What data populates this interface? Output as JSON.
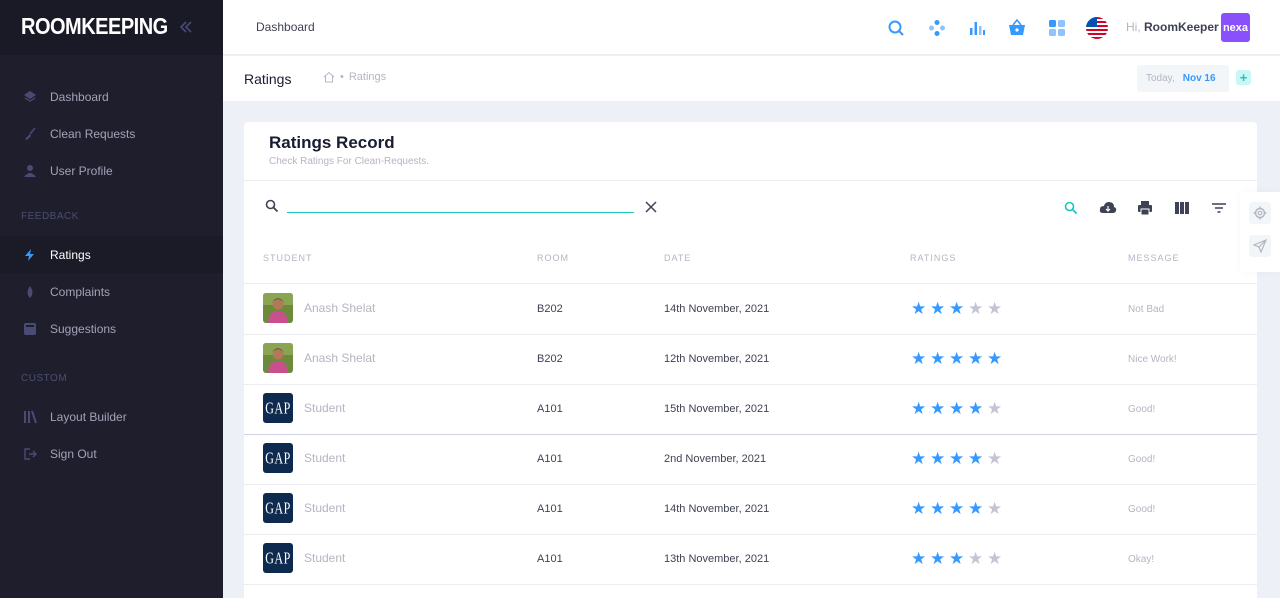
{
  "brand": {
    "name": "ROOMKEEPING"
  },
  "sidebar": {
    "items": [
      {
        "label": "Dashboard",
        "icon": "layers-icon"
      },
      {
        "label": "Clean Requests",
        "icon": "broom-icon"
      },
      {
        "label": "User Profile",
        "icon": "user-icon"
      }
    ],
    "section_feedback": "FEEDBACK",
    "feedback_items": [
      {
        "label": "Ratings",
        "icon": "bolt-icon",
        "active": true
      },
      {
        "label": "Complaints",
        "icon": "drop-icon"
      },
      {
        "label": "Suggestions",
        "icon": "note-icon"
      }
    ],
    "section_custom": "CUSTOM",
    "custom_items": [
      {
        "label": "Layout Builder",
        "icon": "library-icon"
      },
      {
        "label": "Sign Out",
        "icon": "sign-out-icon"
      }
    ]
  },
  "topbar": {
    "tab": "Dashboard",
    "greeting_prefix": "Hi,",
    "user_name": "RoomKeeper",
    "avatar_text": "nexa",
    "icons": [
      "search-icon",
      "cluster-icon",
      "chart-bars-icon",
      "basket-icon",
      "apps-icon",
      "us-flag-icon"
    ]
  },
  "subheader": {
    "title": "Ratings",
    "breadcrumb": "Ratings",
    "today_label": "Today,",
    "today_date": "Nov 16"
  },
  "card": {
    "title": "Ratings Record",
    "subtitle": "Check Ratings For Clean-Requests.",
    "search_value": ""
  },
  "table": {
    "columns": [
      "STUDENT",
      "ROOM",
      "DATE",
      "RATINGS",
      "MESSAGE"
    ],
    "rows": [
      {
        "student": "Anash Shelat",
        "avatar": "photo",
        "room": "B202",
        "date": "14th November, 2021",
        "rating": 3,
        "message": "Not Bad"
      },
      {
        "student": "Anash Shelat",
        "avatar": "photo",
        "room": "B202",
        "date": "12th November, 2021",
        "rating": 5,
        "message": "Nice Work!"
      },
      {
        "student": "Student",
        "avatar": "gap",
        "room": "A101",
        "date": "15th November, 2021",
        "rating": 4,
        "message": "Good!"
      },
      {
        "student": "Student",
        "avatar": "gap",
        "room": "A101",
        "date": "2nd November, 2021",
        "rating": 4,
        "message": "Good!"
      },
      {
        "student": "Student",
        "avatar": "gap",
        "room": "A101",
        "date": "14th November, 2021",
        "rating": 4,
        "message": "Good!"
      },
      {
        "student": "Student",
        "avatar": "gap",
        "room": "A101",
        "date": "13th November, 2021",
        "rating": 3,
        "message": "Okay!"
      }
    ],
    "gap_logo_text": "GAP"
  },
  "colors": {
    "accent": "#3699ff",
    "sidebar": "#1e1e2d",
    "teal": "#1bc5bd",
    "purple": "#8950fc"
  }
}
